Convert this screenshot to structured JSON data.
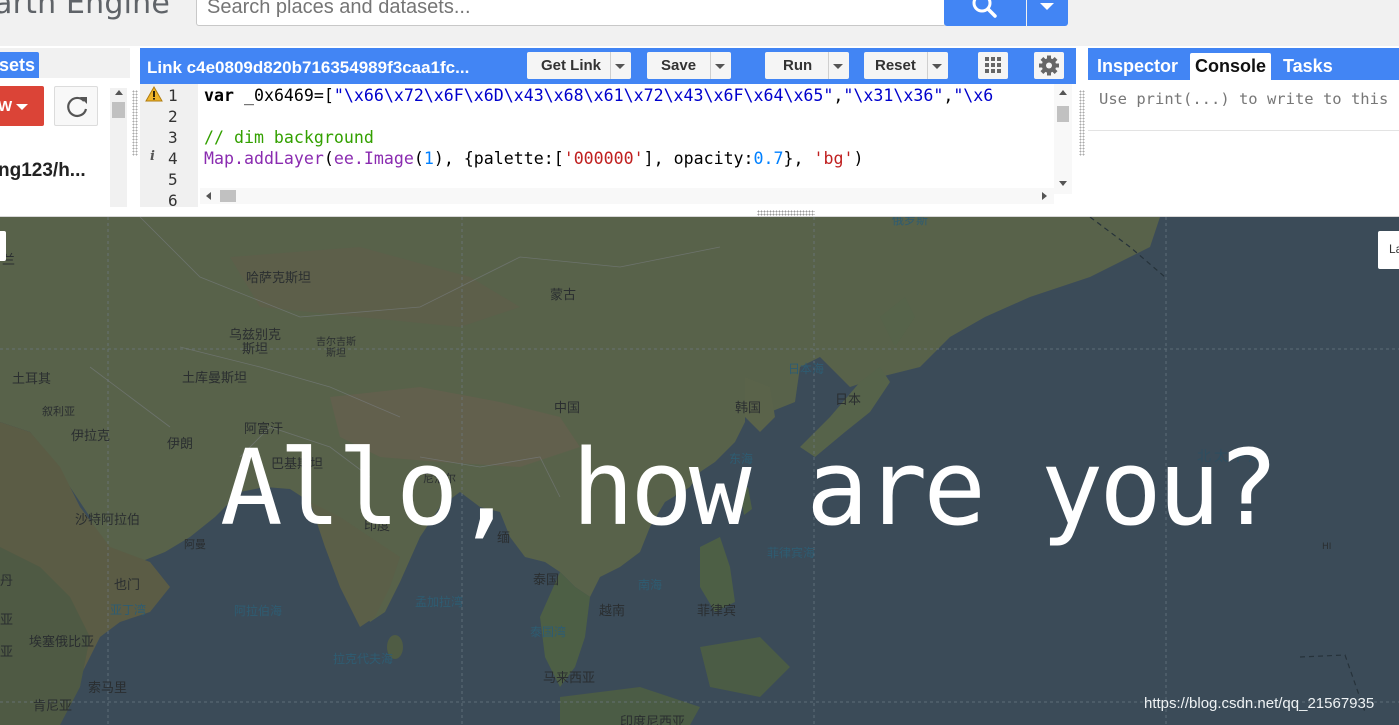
{
  "header": {
    "logo_text": "arth Engine",
    "search_placeholder": "Search places and datasets..."
  },
  "left_panel": {
    "tab_label": "sets",
    "new_button_label": "W",
    "repo_item": "ng123/h..."
  },
  "editor": {
    "script_title": "Link c4e0809d820b716354989f3caa1fc...",
    "buttons": {
      "get_link": "Get Link",
      "save": "Save",
      "run": "Run",
      "reset": "Reset"
    },
    "line_numbers": [
      "1",
      "2",
      "3",
      "4",
      "5",
      "6"
    ],
    "code": {
      "line1_kw": "var",
      "line1_rest": " _0x6469=[",
      "line1_s1": "\"\\x66\\x72\\x6F\\x6D\\x43\\x68\\x61\\x72\\x43\\x6F\\x64\\x65\"",
      "line1_comma1": ",",
      "line1_s2": "\"\\x31\\x36\"",
      "line1_comma2": ",",
      "line1_s3": "\"\\x6",
      "line3_comment": "// dim background",
      "line4_fn": "Map.addLayer",
      "line4_p1": "(",
      "line4_obj": "ee.Image",
      "line4_p2": "(",
      "line4_num1": "1",
      "line4_p3": "), {palette:[",
      "line4_str1": "'000000'",
      "line4_p4": "], opacity:",
      "line4_num2": "0.7",
      "line4_p5": "}, ",
      "line4_str2": "'bg'",
      "line4_p6": ")"
    }
  },
  "right_panel": {
    "tabs": [
      "Inspector",
      "Console",
      "Tasks"
    ],
    "active_tab": "Console",
    "console_hint": "Use print(...) to write to this"
  },
  "map": {
    "overlay_text": "Allo, how are you?",
    "layers_button_label": "La",
    "watermark": "https://blog.csdn.net/qq_21567935",
    "labels": {
      "lan": "兰",
      "kazakhstan": "哈萨克斯坦",
      "mongolia": "蒙古",
      "uzbekistan": "乌兹别克\n斯坦",
      "kyrgyzstan": "吉尔吉斯\n斯坦",
      "turkey": "土耳其",
      "turkmenistan": "土库曼斯坦",
      "syria": "叙利亚",
      "iraq": "伊拉克",
      "afghanistan": "阿富汗",
      "china": "中国",
      "korea": "韩国",
      "japan": "日本",
      "sea_of_japan": "日本海",
      "iran": "伊朗",
      "pakistan": "巴基斯坦",
      "nepal": "尼泊尔",
      "east_sea": "东海",
      "north_pacific": "北太平洋",
      "saudi": "沙特阿拉伯",
      "india": "印度",
      "myanmar": "缅",
      "philippine_sea": "菲律宾海",
      "oman": "阿曼",
      "hi": "HI",
      "dan": "丹",
      "yemen": "也门",
      "thailand": "泰国",
      "south_china_sea": "南海",
      "gulf_aden": "亚丁湾",
      "arabian_sea": "阿拉伯海",
      "bay_of_bengal": "孟加拉湾",
      "vietnam": "越南",
      "philippines": "菲律宾",
      "ethiopia": "埃塞俄比亚",
      "gulf_thailand": "泰国湾",
      "laccadive_sea": "拉克代夫海",
      "somalia": "索马里",
      "malaysia": "马来西亚",
      "kenya": "肯尼亚",
      "indonesia": "印度尼西亚",
      "russia_partial": "俄罗斯",
      "left_a": "亚",
      "left_b": "亚"
    }
  }
}
